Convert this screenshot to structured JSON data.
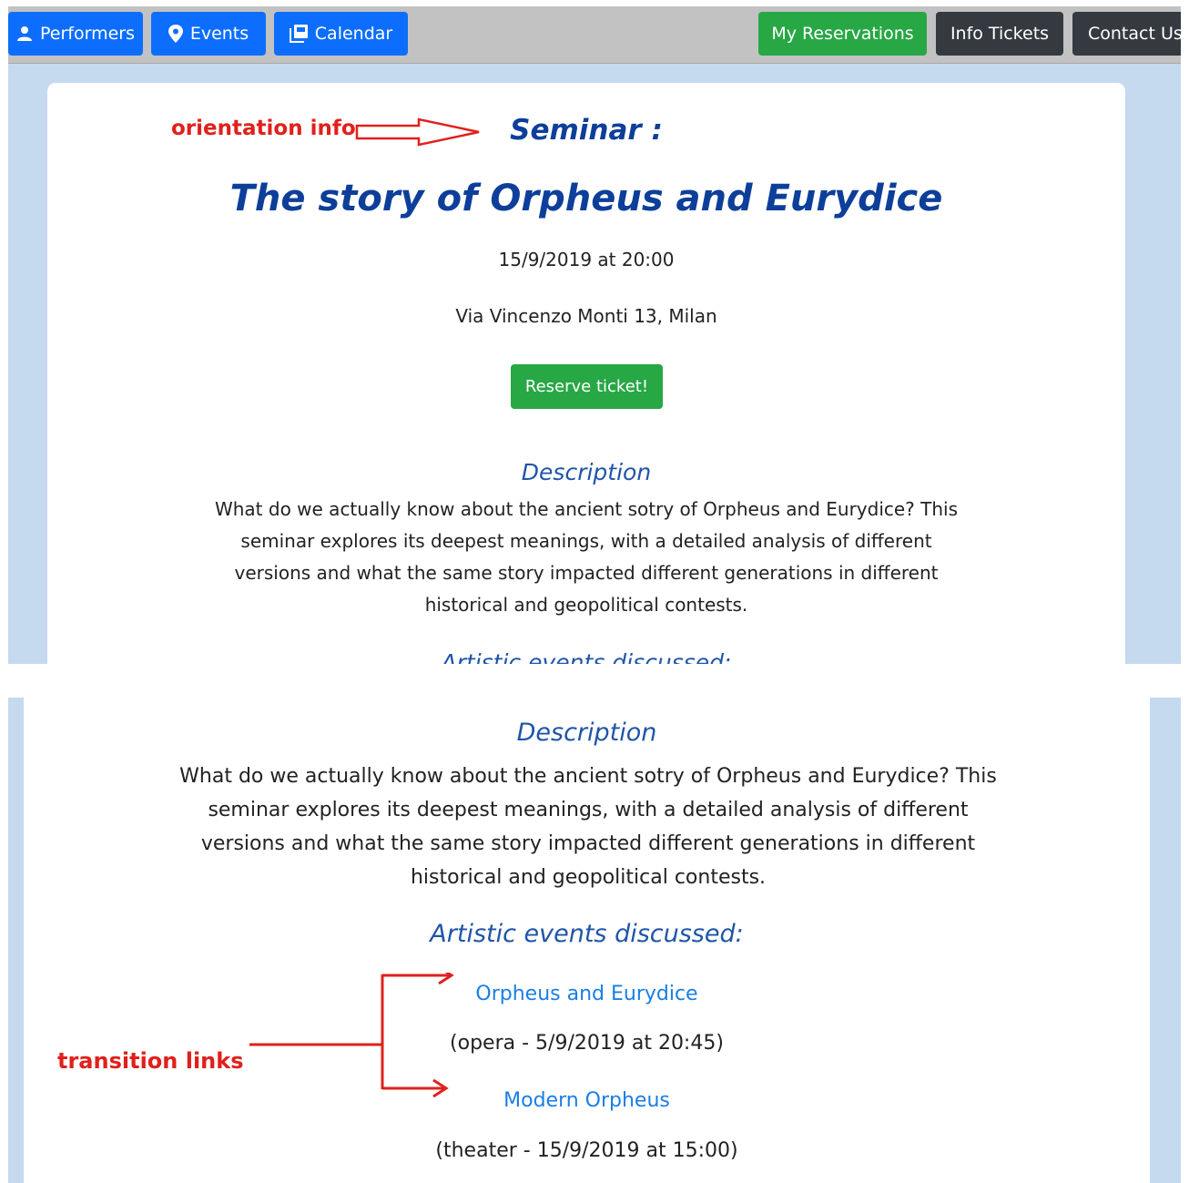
{
  "nav": {
    "left": [
      {
        "label": "Performers",
        "icon": "person-icon"
      },
      {
        "label": "Events",
        "icon": "map-pin-icon"
      },
      {
        "label": "Calendar",
        "icon": "stacked-pages-icon"
      }
    ],
    "right": [
      {
        "label": "My Reservations"
      },
      {
        "label": "Info Tickets"
      },
      {
        "label": "Contact Us"
      }
    ]
  },
  "event": {
    "kind": "Seminar :",
    "title": "The story of Orpheus and Eurydice",
    "datetime": "15/9/2019 at 20:00",
    "location": "Via Vincenzo Monti 13, Milan",
    "reserve_label": "Reserve ticket!",
    "description_heading": "Description",
    "description": "What do we actually know about the ancient sotry of Orpheus and Eurydice? This seminar explores its deepest meanings, with a detailed analysis of different versions and what the same story impacted different generations in different historical and geopolitical contests.",
    "description_lines": [
      "What do we actually know about the ancient sotry of Orpheus and Eurydice? This",
      "seminar explores its deepest meanings, with a detailed analysis of different",
      "versions and what the same story impacted different generations in different",
      "historical and geopolitical contests."
    ],
    "related_heading": "Artistic events discussed:",
    "related": [
      {
        "title": "Orpheus and Eurydice",
        "meta": "(opera - 5/9/2019 at 20:45)"
      },
      {
        "title": "Modern Orpheus",
        "meta": "(theater - 15/9/2019 at 15:00)"
      }
    ]
  },
  "annotations": {
    "orientation": "orientation info",
    "transition": "transition links",
    "color": "#e0201c"
  },
  "colors": {
    "heading_blue": "#0d3f9a",
    "link_blue": "#1a7ee6",
    "nav_blue": "#0d6efd",
    "green": "#28a745",
    "dark": "#343a40",
    "page_bg": "#c5d9ef"
  }
}
